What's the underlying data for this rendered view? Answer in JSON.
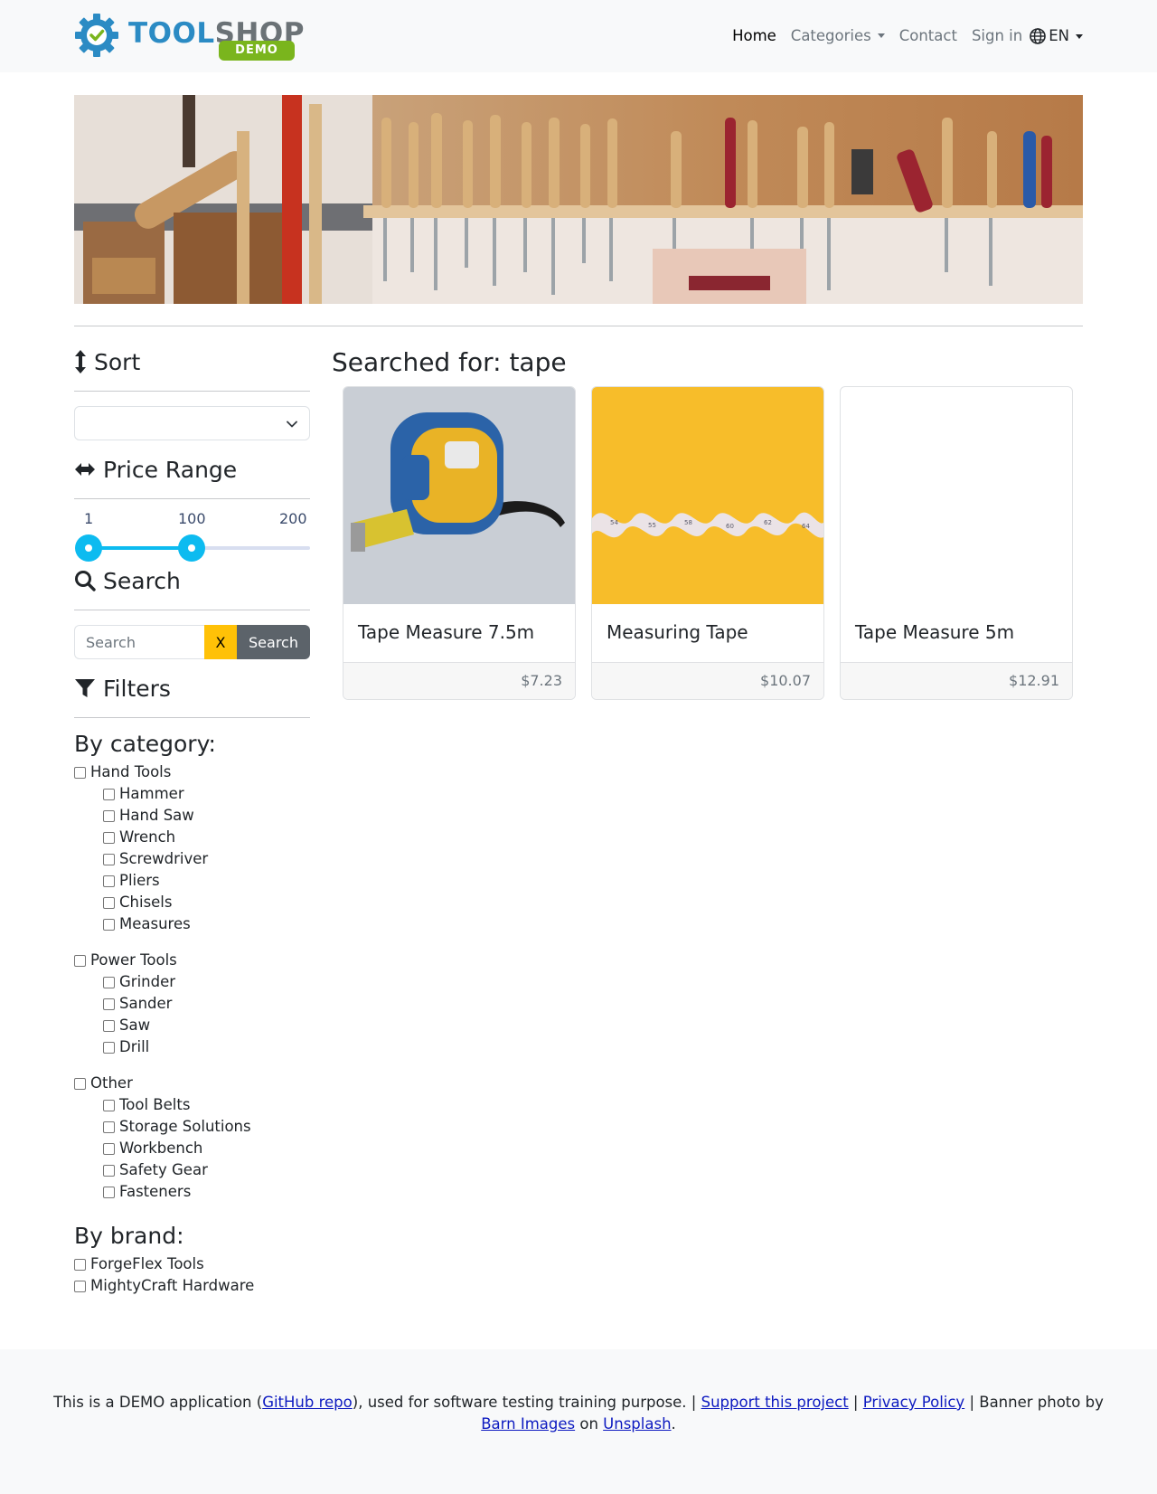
{
  "brand": {
    "word_part1": "TOOL",
    "word_part2": "SHOP",
    "badge": "DEMO"
  },
  "nav": {
    "home": "Home",
    "categories": "Categories",
    "contact": "Contact",
    "sign_in": "Sign in",
    "language": "EN"
  },
  "sidebar": {
    "sort_heading": "Sort",
    "sort_selected": "",
    "price_heading": "Price Range",
    "price_min_label": "1",
    "price_current_label": "100",
    "price_max_label": "200",
    "price_range_min": 1,
    "price_range_max": 200,
    "price_selected_low": 1,
    "price_selected_high": 100,
    "search_heading": "Search",
    "search_placeholder": "Search",
    "clear_label": "X",
    "search_button": "Search",
    "filters_heading": "Filters",
    "by_category": "By category:",
    "categories": [
      {
        "label": "Hand Tools",
        "children": [
          "Hammer",
          "Hand Saw",
          "Wrench",
          "Screwdriver",
          "Pliers",
          "Chisels",
          "Measures"
        ]
      },
      {
        "label": "Power Tools",
        "children": [
          "Grinder",
          "Sander",
          "Saw",
          "Drill"
        ]
      },
      {
        "label": "Other",
        "children": [
          "Tool Belts",
          "Storage Solutions",
          "Workbench",
          "Safety Gear",
          "Fasteners"
        ]
      }
    ],
    "by_brand": "By brand:",
    "brands": [
      "ForgeFlex Tools",
      "MightyCraft Hardware"
    ]
  },
  "main": {
    "searched_for": "Searched for: tape",
    "products": [
      {
        "name": "Tape Measure 7.5m",
        "price": "$7.23"
      },
      {
        "name": "Measuring Tape",
        "price": "$10.07"
      },
      {
        "name": "Tape Measure 5m",
        "price": "$12.91"
      }
    ]
  },
  "footer": {
    "text1": "This is a DEMO application (",
    "github": "GitHub repo",
    "text2": "), used for software testing training purpose. | ",
    "support": "Support this project",
    "sep1": " | ",
    "privacy": "Privacy Policy",
    "text3": " | Banner photo by ",
    "barn": "Barn Images",
    "text4": " on ",
    "unsplash": "Unsplash",
    "text5": "."
  },
  "colors": {
    "accent": "#0dbbf0",
    "clear_button": "#ffc107",
    "search_button": "#5c636a",
    "logo_blue": "#2b8bc4",
    "logo_green": "#7ab51d"
  }
}
